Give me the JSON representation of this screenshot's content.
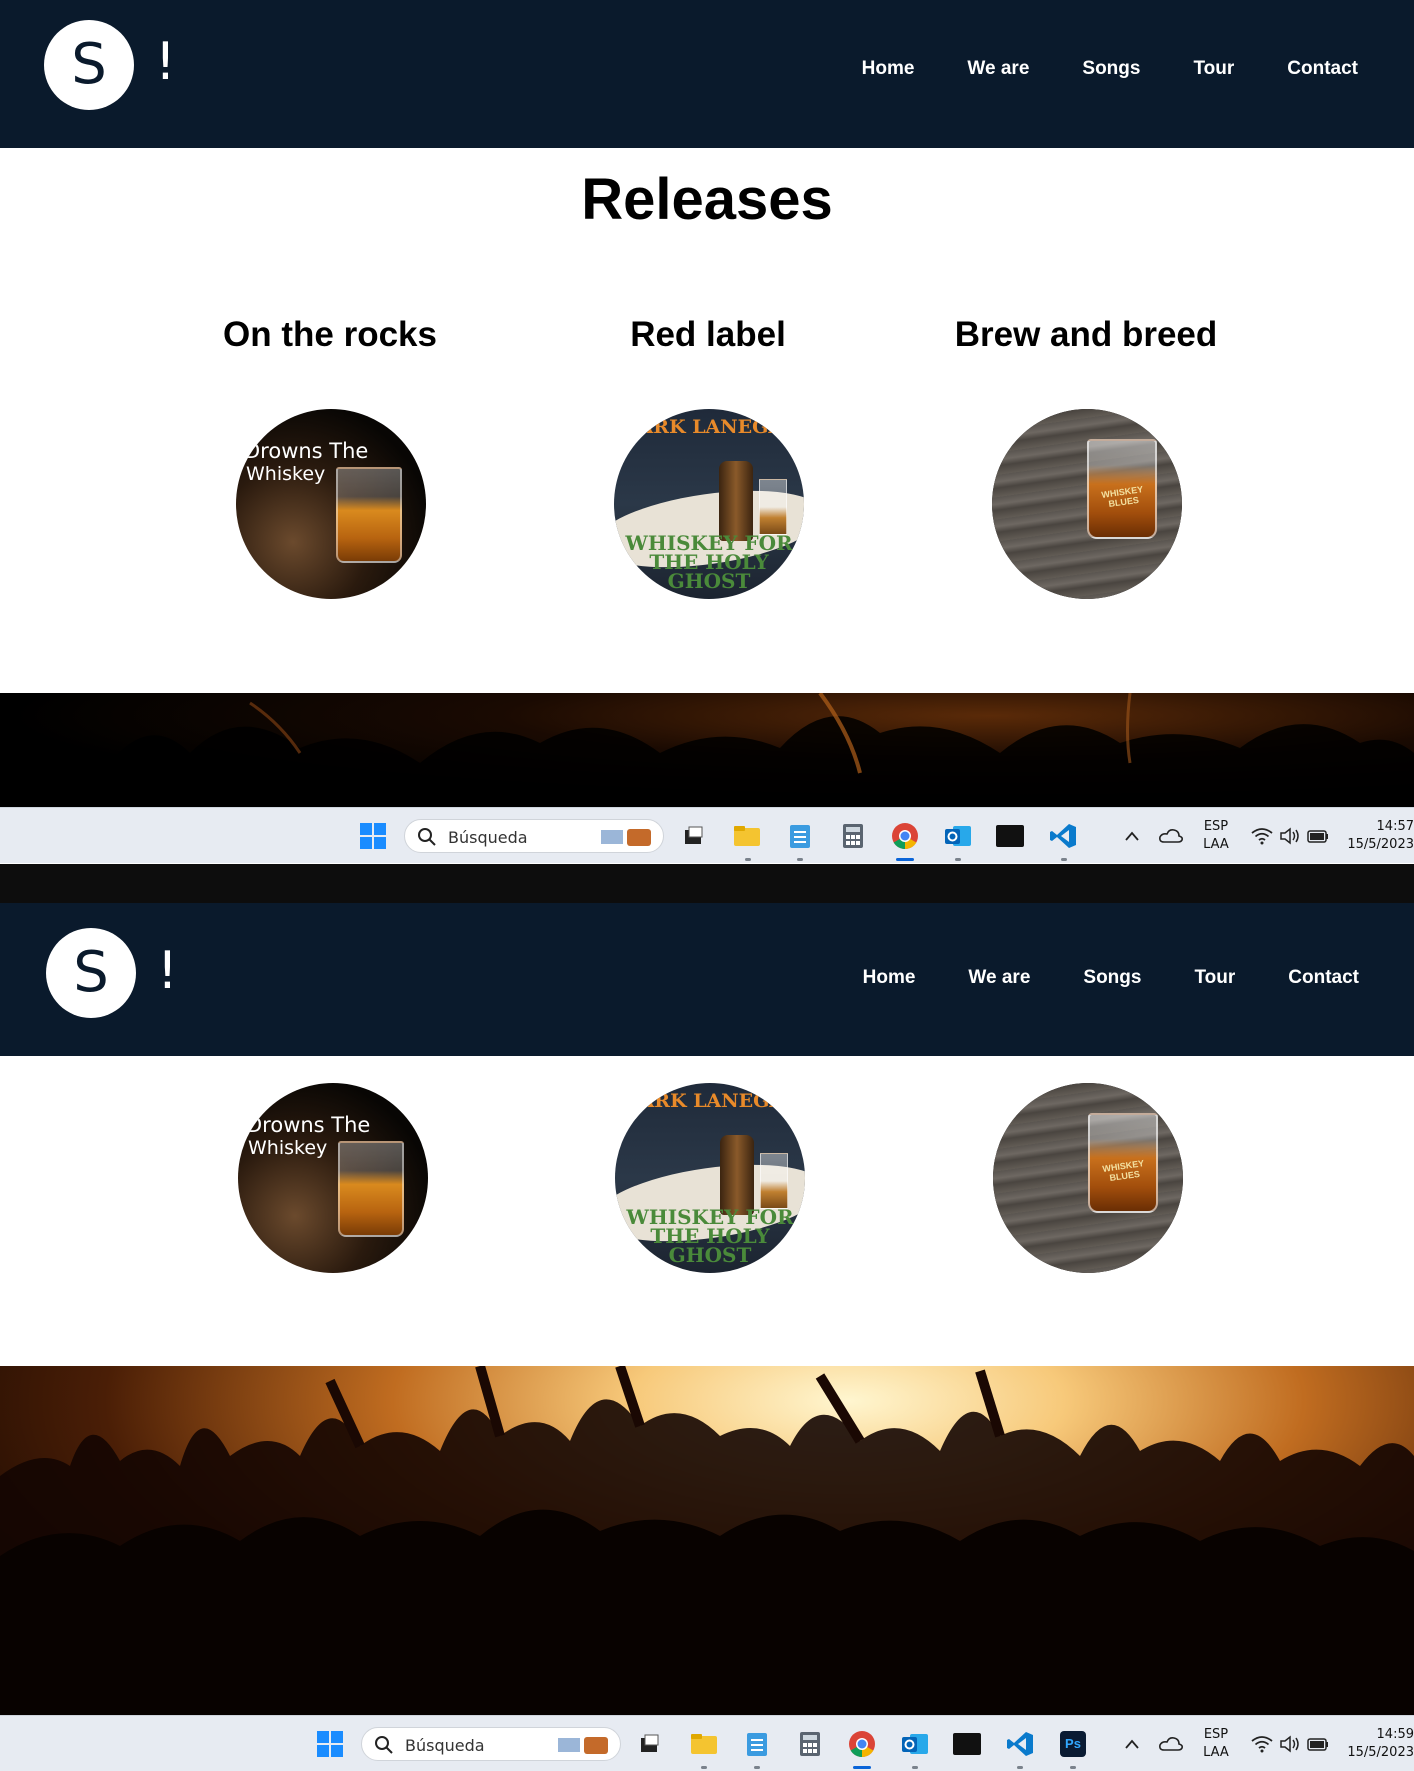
{
  "site": {
    "logo_letter": "S",
    "logo_bang": "!",
    "nav": [
      "Home",
      "We are",
      "Songs",
      "Tour",
      "Contact"
    ]
  },
  "releases": {
    "title": "Releases",
    "items": [
      {
        "name": "On the rocks",
        "cover_text_1": "Drowns The",
        "cover_text_2": "Whiskey"
      },
      {
        "name": "Red label",
        "cover_text_1": "MARK LANEGAN",
        "cover_text_2": "WHISKEY FOR THE HOLY GHOST"
      },
      {
        "name": "Brew and breed",
        "cover_text_1": "WHISKEY BLUES"
      }
    ]
  },
  "taskbar_1": {
    "search_placeholder": "Búsqueda",
    "lang_1": "ESP",
    "lang_2": "LAA",
    "time": "14:57",
    "date": "15/5/2023"
  },
  "taskbar_2": {
    "search_placeholder": "Búsqueda",
    "lang_1": "ESP",
    "lang_2": "LAA",
    "time": "14:59",
    "date": "15/5/2023",
    "ps_label": "Ps"
  },
  "icons": [
    "windows-start-icon",
    "search-icon",
    "task-view-icon",
    "file-explorer-icon",
    "notepad-icon",
    "calculator-icon",
    "chrome-icon",
    "outlook-icon",
    "terminal-icon",
    "vscode-icon",
    "photoshop-icon",
    "chevron-up-icon",
    "onedrive-cloud-icon",
    "wifi-icon",
    "volume-icon",
    "battery-icon"
  ],
  "colors": {
    "header_bg": "#0a1a2c",
    "taskbar_bg": "#e7ebf2",
    "accent": "#0a64d8"
  }
}
